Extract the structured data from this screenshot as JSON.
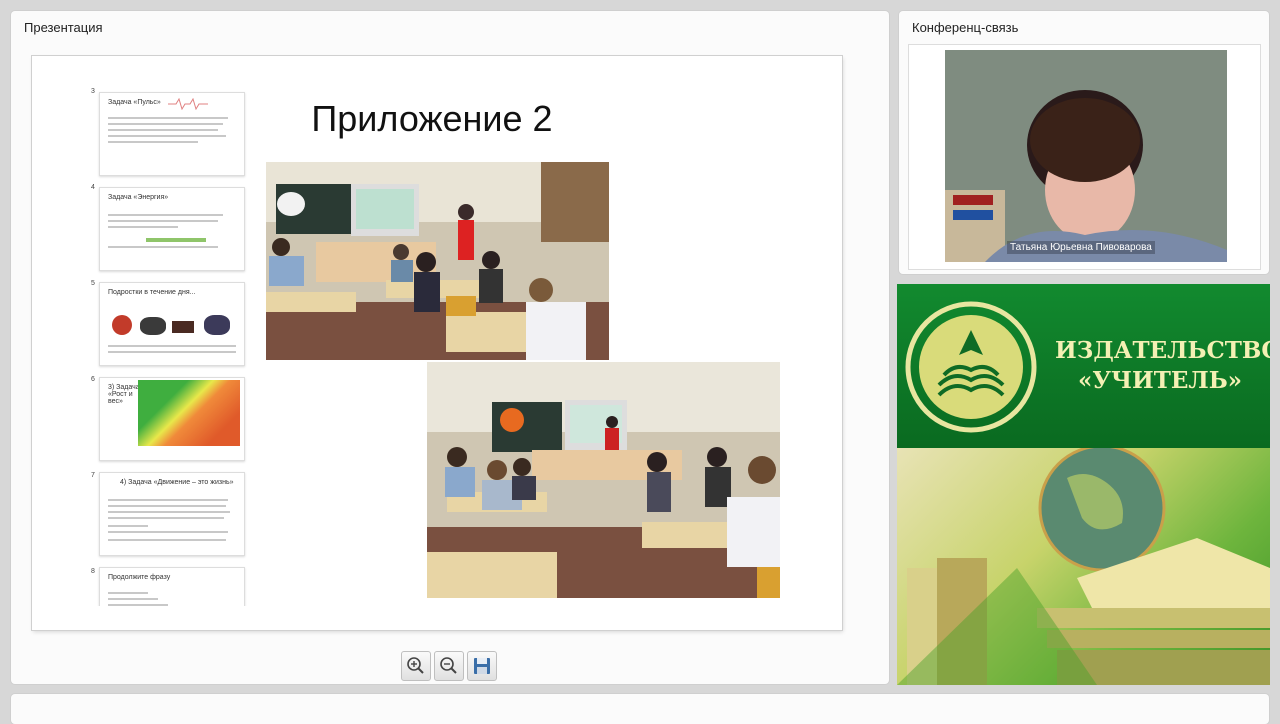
{
  "presentation": {
    "panel_title": "Презентация",
    "slide_title": "Приложение 2",
    "thumbnails": [
      {
        "num": "3",
        "title": "Задача «Пульс»"
      },
      {
        "num": "4",
        "title": "Задача «Энергия»"
      },
      {
        "num": "5",
        "title": "Подростки в течение дня..."
      },
      {
        "num": "6",
        "title": "3) Задача «Рост и вес»"
      },
      {
        "num": "7",
        "title": "4) Задача «Движение – это жизнь»"
      },
      {
        "num": "8",
        "title": "Продолжите фразу"
      }
    ],
    "toolbar": {
      "zoom_in": "zoom-in-icon",
      "zoom_out": "zoom-out-icon",
      "save": "save-icon"
    }
  },
  "conference": {
    "panel_title": "Конференц-связь",
    "participant_name": "Татьяна Юрьевна Пивоварова"
  },
  "ad": {
    "line1": "ИЗДАТЕЛЬСТВО",
    "line2": "«УЧИТЕЛЬ»"
  },
  "colors": {
    "brand_green": "#0f7a2a",
    "brand_text": "#f4f0b4"
  }
}
